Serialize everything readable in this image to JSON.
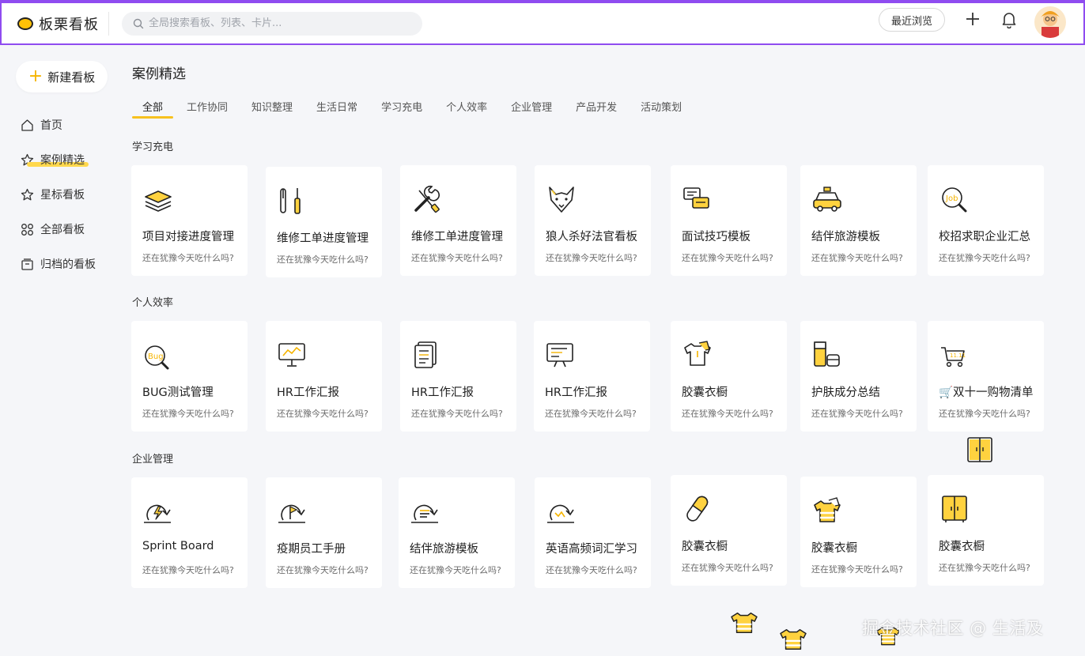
{
  "app": {
    "name": "板栗看板"
  },
  "search": {
    "placeholder": "全局搜索看板、列表、卡片..."
  },
  "header": {
    "recent_label": "最近浏览"
  },
  "sidebar": {
    "new_board_label": "新建看板",
    "items": [
      {
        "label": "首页",
        "icon": "home-icon"
      },
      {
        "label": "案例精选",
        "icon": "star-icon",
        "active": true
      },
      {
        "label": "星标看板",
        "icon": "star-outline-icon"
      },
      {
        "label": "全部看板",
        "icon": "grid-icon"
      },
      {
        "label": "归档的看板",
        "icon": "archive-icon"
      }
    ]
  },
  "main": {
    "title": "案例精选",
    "tabs": [
      "全部",
      "工作协同",
      "知识整理",
      "生活日常",
      "学习充电",
      "个人效率",
      "企业管理",
      "产品开发",
      "活动策划"
    ],
    "active_tab": "全部",
    "sections": [
      {
        "title": "学习充电",
        "cards": [
          {
            "title": "项目对接进度管理",
            "subtitle": "还在犹豫今天吃什么吗?",
            "icon": "layers-icon"
          },
          {
            "title": "维修工单进度管理",
            "subtitle": "还在犹豫今天吃什么吗?",
            "icon": "screwdriver-icon"
          },
          {
            "title": "维修工单进度管理",
            "subtitle": "还在犹豫今天吃什么吗?",
            "icon": "wrench-icon"
          },
          {
            "title": "狼人杀好法官看板",
            "subtitle": "还在犹豫今天吃什么吗?",
            "icon": "wolf-icon"
          },
          {
            "title": "面试技巧模板",
            "subtitle": "还在犹豫今天吃什么吗?",
            "icon": "chat-icon"
          },
          {
            "title": "结伴旅游模板",
            "subtitle": "还在犹豫今天吃什么吗?",
            "icon": "taxi-icon"
          },
          {
            "title": "校招求职企业汇总",
            "subtitle": "还在犹豫今天吃什么吗?",
            "icon": "job-search-icon"
          }
        ]
      },
      {
        "title": "个人效率",
        "cards": [
          {
            "title": "BUG测试管理",
            "subtitle": "还在犹豫今天吃什么吗?",
            "icon": "bug-search-icon"
          },
          {
            "title": "HR工作汇报",
            "subtitle": "还在犹豫今天吃什么吗?",
            "icon": "presentation-icon"
          },
          {
            "title": "HR工作汇报",
            "subtitle": "还在犹豫今天吃什么吗?",
            "icon": "document-icon"
          },
          {
            "title": "HR工作汇报",
            "subtitle": "还在犹豫今天吃什么吗?",
            "icon": "board-icon"
          },
          {
            "title": "胶囊衣橱",
            "subtitle": "还在犹豫今天吃什么吗?",
            "icon": "shirt-icon"
          },
          {
            "title": "护肤成分总结",
            "subtitle": "还在犹豫今天吃什么吗?",
            "icon": "cosmetics-icon"
          },
          {
            "title": "🛒双十一购物清单",
            "subtitle": "还在犹豫今天吃什么吗?",
            "icon": "cart-icon"
          }
        ]
      },
      {
        "title": "企业管理",
        "cards": [
          {
            "title": "Sprint Board",
            "subtitle": "还在犹豫今天吃什么吗?",
            "icon": "sprint-lightning-icon"
          },
          {
            "title": "疫期员工手册",
            "subtitle": "还在犹豫今天吃什么吗?",
            "icon": "sprint-flag-icon"
          },
          {
            "title": "结伴旅游模板",
            "subtitle": "还在犹豫今天吃什么吗?",
            "icon": "sprint-list-icon"
          },
          {
            "title": "英语高频词汇学习",
            "subtitle": "还在犹豫今天吃什么吗?",
            "icon": "sprint-chart-icon"
          },
          {
            "title": "胶囊衣橱",
            "subtitle": "还在犹豫今天吃什么吗?",
            "icon": "capsule-icon"
          },
          {
            "title": "胶囊衣橱",
            "subtitle": "还在犹豫今天吃什么吗?",
            "icon": "shirt-striped-icon"
          },
          {
            "title": "胶囊衣橱",
            "subtitle": "还在犹豫今天吃什么吗?",
            "icon": "wardrobe-icon"
          }
        ]
      }
    ]
  },
  "watermark": "掘金技术社区 @ 生活及",
  "colors": {
    "accent": "#f7c11e",
    "frame": "#8f4cf0",
    "background": "#f5f6f9"
  }
}
